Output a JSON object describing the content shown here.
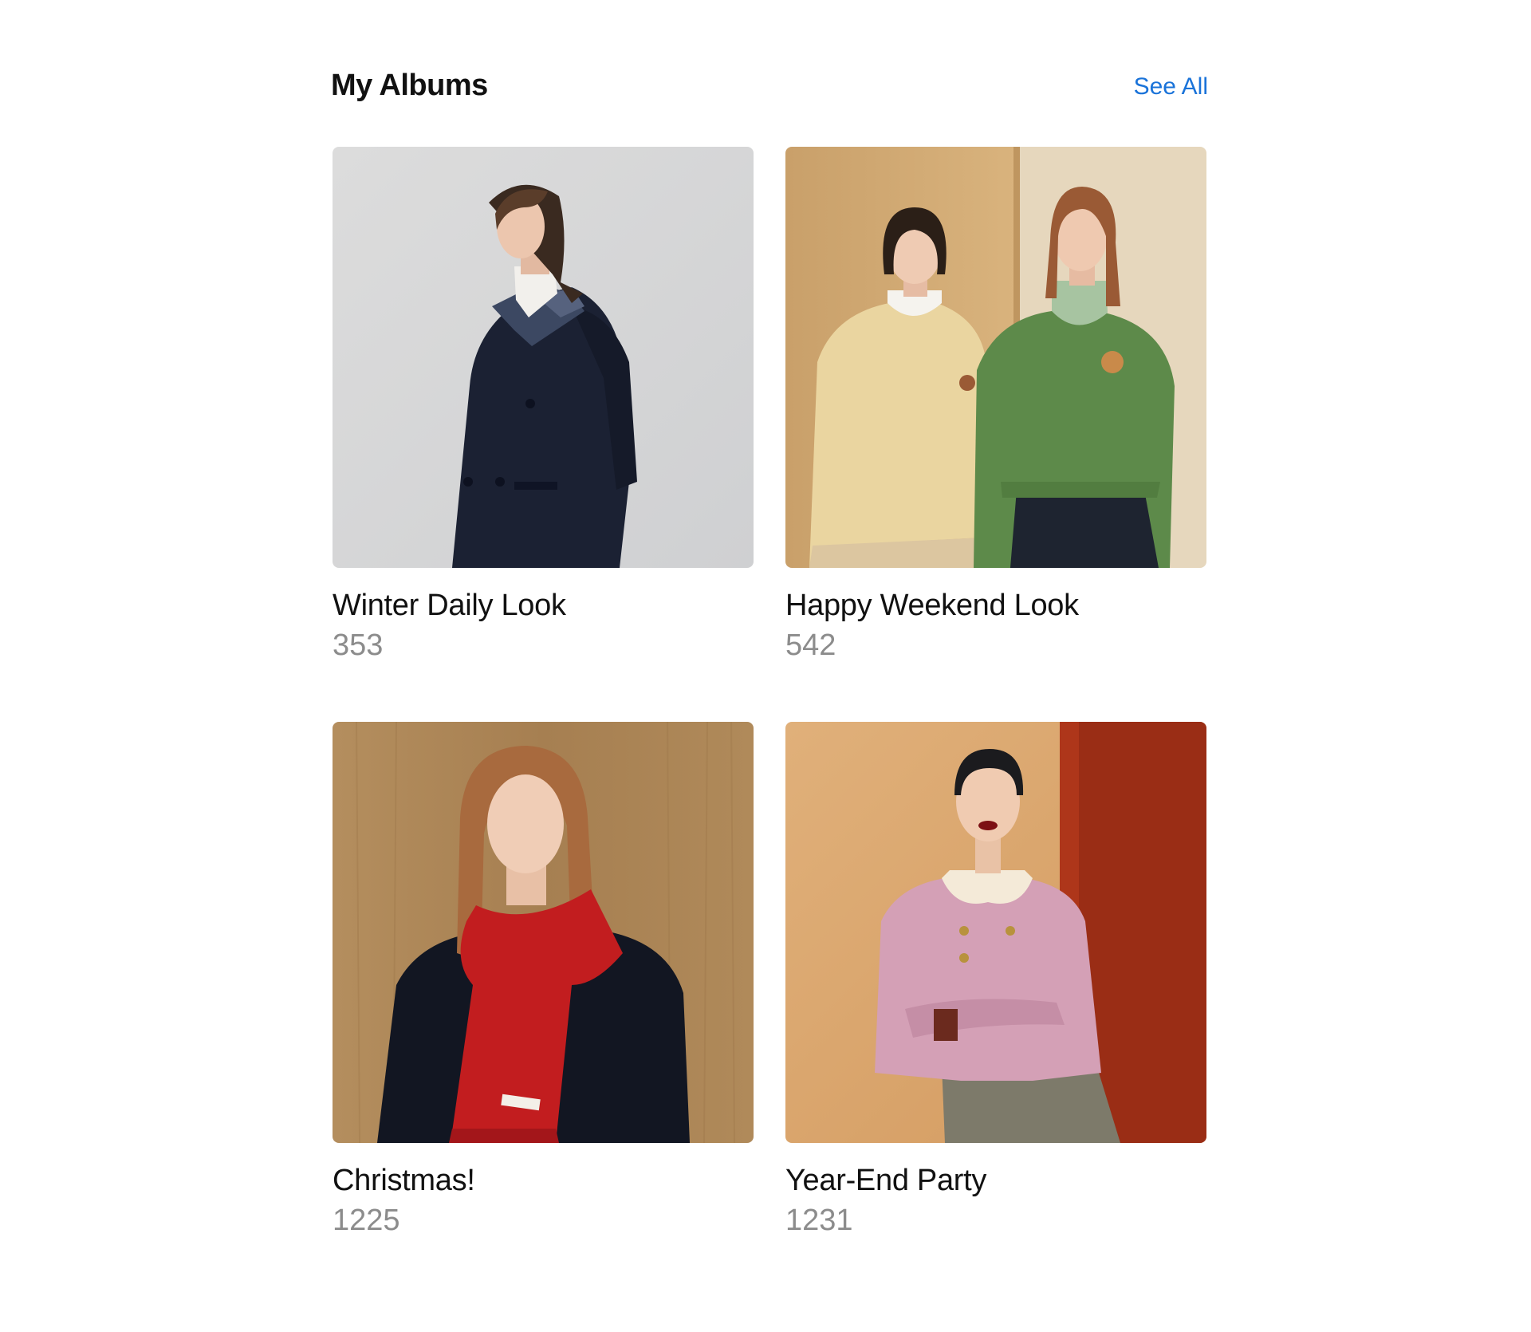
{
  "header": {
    "title": "My Albums",
    "see_all_label": "See All"
  },
  "albums": [
    {
      "title": "Winter Daily Look",
      "count": "353",
      "thumbnail": "woman-navy-coat-photo"
    },
    {
      "title": "Happy Weekend Look",
      "count": "542",
      "thumbnail": "two-women-sweaters-photo"
    },
    {
      "title": "Christmas!",
      "count": "1225",
      "thumbnail": "woman-red-scarf-photo"
    },
    {
      "title": "Year-End Party",
      "count": "1231",
      "thumbnail": "woman-pink-jacket-photo"
    }
  ],
  "colors": {
    "accent": "#1a73d9",
    "title_text": "#111111",
    "count_text": "#8c8c8c"
  }
}
